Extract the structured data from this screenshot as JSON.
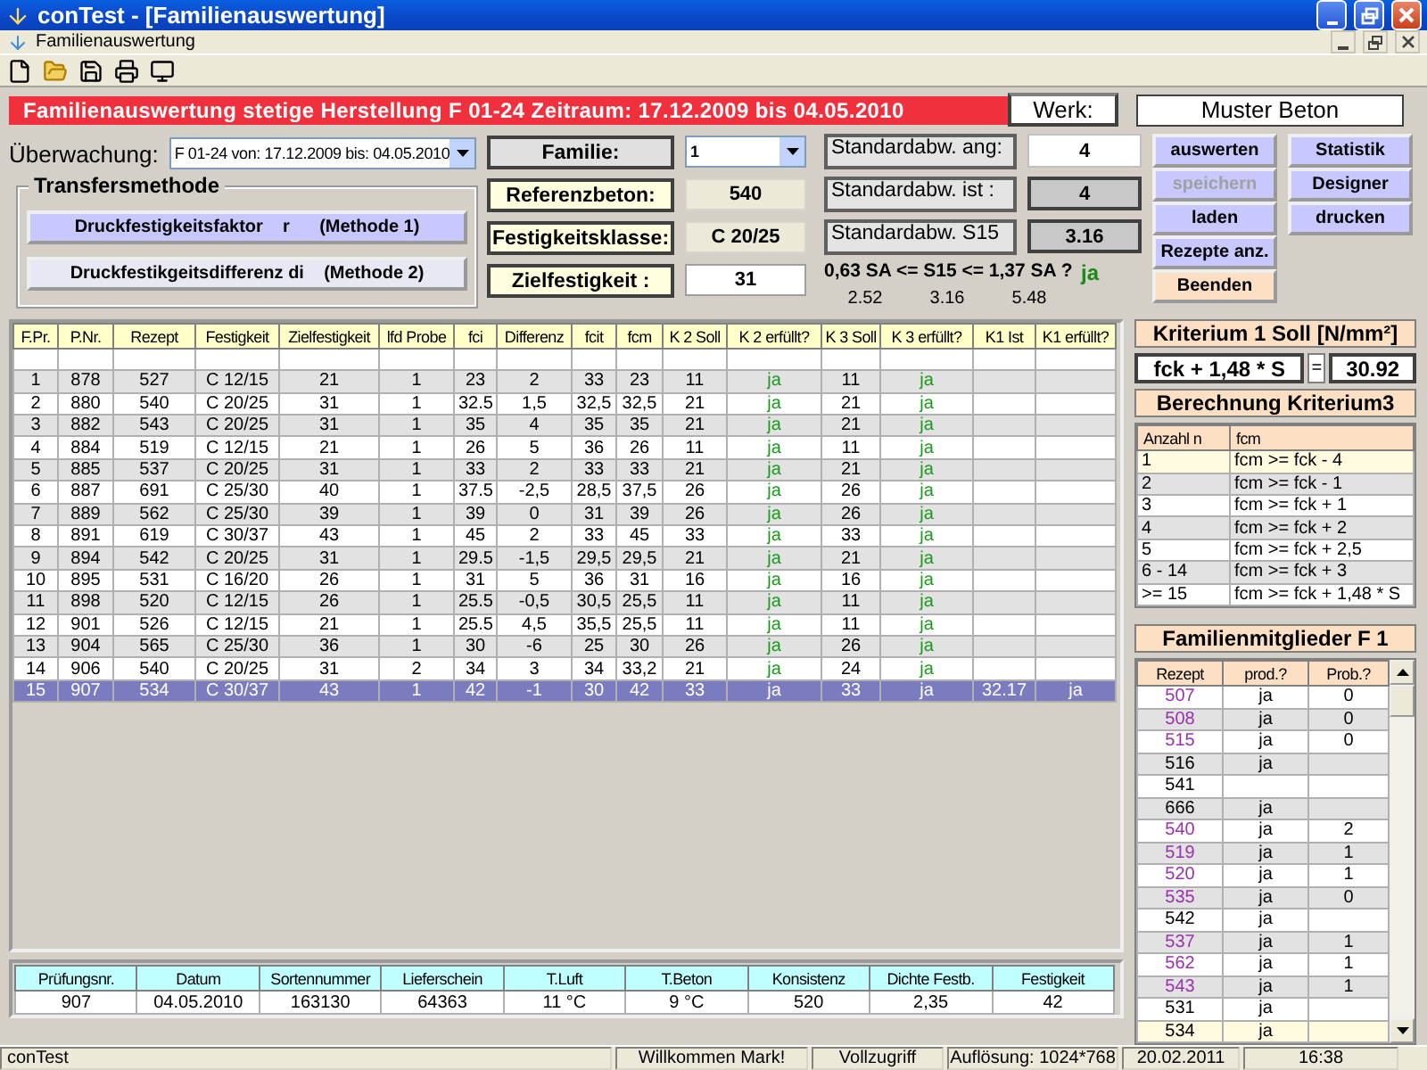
{
  "window": {
    "title": "conTest - [Familienauswertung]"
  },
  "menu_bar": {
    "title": "Familienauswertung"
  },
  "banner": "Familienauswertung stetige Herstellung F 01-24 Zeitraum: 17.12.2009 bis 04.05.2010",
  "werk": {
    "label": "Werk:",
    "value": "Muster Beton"
  },
  "ueberwachung": {
    "label": "Überwachung:",
    "value": "F 01-24 von: 17.12.2009 bis: 04.05.2010"
  },
  "transfer": {
    "title": "Transfersmethode",
    "options": [
      {
        "label": "Druckfestigkeitsfaktor    r      (Methode 1)",
        "selected": true
      },
      {
        "label": "Druckfestikgeitsdifferenz di    (Methode 2)",
        "selected": false
      }
    ]
  },
  "fields": [
    {
      "label": "Familie:",
      "kind": "combo",
      "value": "1"
    },
    {
      "label": "Referenzbeton:",
      "kind": "readonly",
      "value": "540"
    },
    {
      "label": "Festigkeitsklasse:",
      "kind": "readonly",
      "value": "C 20/25"
    },
    {
      "label": "Zielfestigkeit :",
      "kind": "input",
      "value": "31"
    }
  ],
  "std": [
    {
      "label": "Standardabw. ang:",
      "kind": "input",
      "value": "4"
    },
    {
      "label": "Standardabw. ist :",
      "kind": "readonly",
      "value": "4"
    },
    {
      "label": "Standardabw. S15",
      "kind": "readonly",
      "value": "3.16"
    }
  ],
  "check": {
    "formula": "0,63 SA <= S15 <= 1,37 SA ?",
    "result": "ja",
    "values": [
      "2.52",
      "3.16",
      "5.48"
    ]
  },
  "buttons": [
    {
      "label": "auswerten",
      "kind": "normal",
      "disabled": false
    },
    {
      "label": "speichern",
      "kind": "normal",
      "disabled": true
    },
    {
      "label": "laden",
      "kind": "normal",
      "disabled": false
    },
    {
      "label": "Rezepte anz.",
      "kind": "normal",
      "disabled": false
    },
    {
      "label": "Beenden",
      "kind": "exit",
      "disabled": false
    }
  ],
  "buttons_2": [
    {
      "label": "Statistik",
      "disabled": false
    },
    {
      "label": "Designer",
      "disabled": false
    },
    {
      "label": "drucken",
      "disabled": false
    }
  ],
  "table": {
    "columns": [
      {
        "label": "F.Pr.",
        "kind": "text"
      },
      {
        "label": "P.Nr.",
        "kind": "text"
      },
      {
        "label": "Rezept",
        "kind": "text"
      },
      {
        "label": "Festigkeit",
        "kind": "text"
      },
      {
        "label": "Zielfestigkeit",
        "kind": "text"
      },
      {
        "label": "lfd Probe",
        "kind": "text"
      },
      {
        "label": "fci",
        "kind": "text"
      },
      {
        "label": "Differenz",
        "kind": "text"
      },
      {
        "label": "fcit",
        "kind": "text"
      },
      {
        "label": "fcm",
        "kind": "text"
      },
      {
        "label": "K 2 Soll",
        "kind": "text"
      },
      {
        "label": "K 2 erfüllt?",
        "kind": "check"
      },
      {
        "label": "K 3 Soll",
        "kind": "text"
      },
      {
        "label": "K 3 erfüllt?",
        "kind": "check"
      },
      {
        "label": "K1 Ist",
        "kind": "text"
      },
      {
        "label": "K1 erfüllt?",
        "kind": "check"
      }
    ],
    "rows": [
      {
        "cells": [
          "1",
          "878",
          "527",
          "C 12/15",
          "21",
          "1",
          "23",
          "2",
          "33",
          "23",
          "11",
          "ja",
          "11",
          "ja",
          "",
          ""
        ],
        "selected": false
      },
      {
        "cells": [
          "2",
          "880",
          "540",
          "C 20/25",
          "31",
          "1",
          "32.5",
          "1,5",
          "32,5",
          "32,5",
          "21",
          "ja",
          "21",
          "ja",
          "",
          ""
        ],
        "selected": false
      },
      {
        "cells": [
          "3",
          "882",
          "543",
          "C 20/25",
          "31",
          "1",
          "35",
          "4",
          "35",
          "35",
          "21",
          "ja",
          "21",
          "ja",
          "",
          ""
        ],
        "selected": false
      },
      {
        "cells": [
          "4",
          "884",
          "519",
          "C 12/15",
          "21",
          "1",
          "26",
          "5",
          "36",
          "26",
          "11",
          "ja",
          "11",
          "ja",
          "",
          ""
        ],
        "selected": false
      },
      {
        "cells": [
          "5",
          "885",
          "537",
          "C 20/25",
          "31",
          "1",
          "33",
          "2",
          "33",
          "33",
          "21",
          "ja",
          "21",
          "ja",
          "",
          ""
        ],
        "selected": false
      },
      {
        "cells": [
          "6",
          "887",
          "691",
          "C 25/30",
          "40",
          "1",
          "37.5",
          "-2,5",
          "28,5",
          "37,5",
          "26",
          "ja",
          "26",
          "ja",
          "",
          ""
        ],
        "selected": false
      },
      {
        "cells": [
          "7",
          "889",
          "562",
          "C 25/30",
          "39",
          "1",
          "39",
          "0",
          "31",
          "39",
          "26",
          "ja",
          "26",
          "ja",
          "",
          ""
        ],
        "selected": false
      },
      {
        "cells": [
          "8",
          "891",
          "619",
          "C 30/37",
          "43",
          "1",
          "45",
          "2",
          "33",
          "45",
          "33",
          "ja",
          "33",
          "ja",
          "",
          ""
        ],
        "selected": false
      },
      {
        "cells": [
          "9",
          "894",
          "542",
          "C 20/25",
          "31",
          "1",
          "29.5",
          "-1,5",
          "29,5",
          "29,5",
          "21",
          "ja",
          "21",
          "ja",
          "",
          ""
        ],
        "selected": false
      },
      {
        "cells": [
          "10",
          "895",
          "531",
          "C 16/20",
          "26",
          "1",
          "31",
          "5",
          "36",
          "31",
          "16",
          "ja",
          "16",
          "ja",
          "",
          ""
        ],
        "selected": false
      },
      {
        "cells": [
          "11",
          "898",
          "520",
          "C 12/15",
          "26",
          "1",
          "25.5",
          "-0,5",
          "30,5",
          "25,5",
          "11",
          "ja",
          "11",
          "ja",
          "",
          ""
        ],
        "selected": false
      },
      {
        "cells": [
          "12",
          "901",
          "526",
          "C 12/15",
          "21",
          "1",
          "25.5",
          "4,5",
          "35,5",
          "25,5",
          "11",
          "ja",
          "11",
          "ja",
          "",
          ""
        ],
        "selected": false
      },
      {
        "cells": [
          "13",
          "904",
          "565",
          "C 25/30",
          "36",
          "1",
          "30",
          "-6",
          "25",
          "30",
          "26",
          "ja",
          "26",
          "ja",
          "",
          ""
        ],
        "selected": false
      },
      {
        "cells": [
          "14",
          "906",
          "540",
          "C 20/25",
          "31",
          "2",
          "34",
          "3",
          "34",
          "33,2",
          "21",
          "ja",
          "24",
          "ja",
          "",
          ""
        ],
        "selected": false
      },
      {
        "cells": [
          "15",
          "907",
          "534",
          "C 30/37",
          "43",
          "1",
          "42",
          "-1",
          "30",
          "42",
          "33",
          "ja",
          "33",
          "ja",
          "32.17",
          "ja"
        ],
        "selected": true
      }
    ]
  },
  "sample": {
    "columns": [
      "Prüfungsnr.",
      "Datum",
      "Sortennummer",
      "Lieferschein",
      "T.Luft",
      "T.Beton",
      "Konsistenz",
      "Dichte Festb.",
      "Festigkeit"
    ],
    "values": [
      "907",
      "04.05.2010",
      "163130",
      "64363",
      "11 °C",
      "9 °C",
      "520",
      "2,35",
      "42"
    ]
  },
  "kriterium1": {
    "title": "Kriterium 1 Soll [N/mm²]",
    "formula": "fck + 1,48 * S",
    "equals": "=",
    "value": "30.92"
  },
  "kriterium3": {
    "title": "Berechnung Kriterium3",
    "columns": [
      "Anzahl n",
      "fcm"
    ],
    "rows": [
      {
        "cells": [
          "1",
          "fcm >= fck - 4"
        ],
        "selected": true
      },
      {
        "cells": [
          "2",
          "fcm >= fck - 1"
        ],
        "selected": false
      },
      {
        "cells": [
          "3",
          "fcm >= fck + 1"
        ],
        "selected": false
      },
      {
        "cells": [
          "4",
          "fcm >= fck + 2"
        ],
        "selected": false
      },
      {
        "cells": [
          "5",
          "fcm >= fck + 2,5"
        ],
        "selected": false
      },
      {
        "cells": [
          "6 - 14",
          "fcm >= fck + 3"
        ],
        "selected": false
      },
      {
        "cells": [
          ">= 15",
          "fcm >= fck + 1,48 * S"
        ],
        "selected": false
      }
    ]
  },
  "familie": {
    "title": "Familienmitglieder F 1",
    "columns": [
      "Rezept",
      "prod.?",
      "Prob.?"
    ],
    "rows": [
      {
        "rezept": "507",
        "color": "#9b30b0",
        "prod": "ja",
        "prob": "0",
        "selected": false
      },
      {
        "rezept": "508",
        "color": "#9b30b0",
        "prod": "ja",
        "prob": "0",
        "selected": false
      },
      {
        "rezept": "515",
        "color": "#9b30b0",
        "prod": "ja",
        "prob": "0",
        "selected": false
      },
      {
        "rezept": "516",
        "color": "#000000",
        "prod": "ja",
        "prob": "",
        "selected": false
      },
      {
        "rezept": "541",
        "color": "#000000",
        "prod": "",
        "prob": "",
        "selected": false
      },
      {
        "rezept": "666",
        "color": "#000000",
        "prod": "ja",
        "prob": "",
        "selected": false
      },
      {
        "rezept": "540",
        "color": "#9b30b0",
        "prod": "ja",
        "prob": "2",
        "selected": false
      },
      {
        "rezept": "519",
        "color": "#9b30b0",
        "prod": "ja",
        "prob": "1",
        "selected": false
      },
      {
        "rezept": "520",
        "color": "#9b30b0",
        "prod": "ja",
        "prob": "1",
        "selected": false
      },
      {
        "rezept": "535",
        "color": "#9b30b0",
        "prod": "ja",
        "prob": "0",
        "selected": false
      },
      {
        "rezept": "542",
        "color": "#000000",
        "prod": "ja",
        "prob": "",
        "selected": false
      },
      {
        "rezept": "537",
        "color": "#9b30b0",
        "prod": "ja",
        "prob": "1",
        "selected": false
      },
      {
        "rezept": "562",
        "color": "#9b30b0",
        "prod": "ja",
        "prob": "1",
        "selected": false
      },
      {
        "rezept": "543",
        "color": "#9b30b0",
        "prod": "ja",
        "prob": "1",
        "selected": false
      },
      {
        "rezept": "531",
        "color": "#000000",
        "prod": "ja",
        "prob": "",
        "selected": false
      },
      {
        "rezept": "534",
        "color": "#000000",
        "prod": "ja",
        "prob": "",
        "selected": true
      }
    ]
  },
  "status_bar": [
    "conTest",
    "Willkommen Mark!",
    "Vollzugriff",
    "Auflösung: 1024*768",
    "20.02.2011",
    "16:38"
  ]
}
